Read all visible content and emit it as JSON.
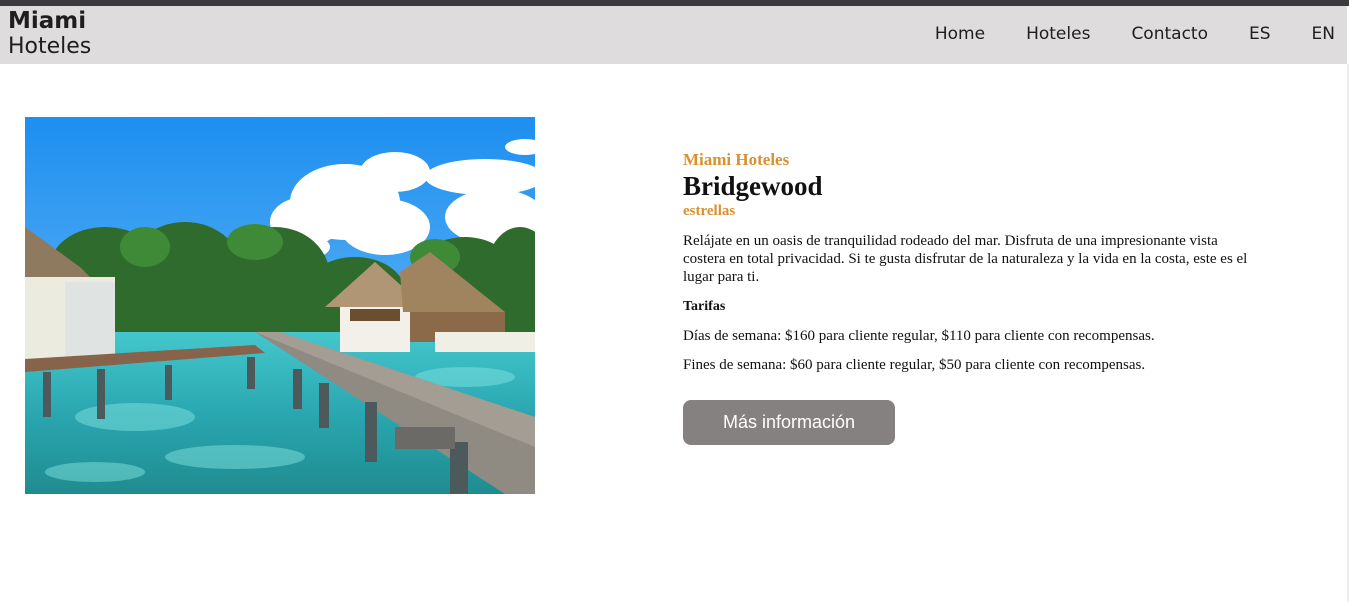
{
  "header": {
    "brand_line1": "Miami",
    "brand_line2": "Hoteles",
    "nav": [
      {
        "label": "Home"
      },
      {
        "label": "Hoteles"
      },
      {
        "label": "Contacto"
      },
      {
        "label": "ES"
      },
      {
        "label": "EN"
      }
    ]
  },
  "hotel": {
    "eyebrow": "Miami Hoteles",
    "name": "Bridgewood",
    "stars_label": "estrellas",
    "description": "Relájate en un oasis de tranquilidad rodeado del mar. Disfruta de una impresionante vista costera en total privacidad. Si te gusta disfrutar de la naturaleza y la vida en la costa, este es el lugar para ti.",
    "rates_title": "Tarifas",
    "weekday_rate": "Días de semana: $160 para cliente regular, $110 para cliente con recompensas.",
    "weekend_rate": "Fines de semana: $60 para cliente regular, $50 para cliente con recompensas.",
    "cta_label": "Más información"
  },
  "colors": {
    "accent": "#d8912e",
    "navbar_bg": "#dedcdd",
    "button_bg": "#858180"
  }
}
